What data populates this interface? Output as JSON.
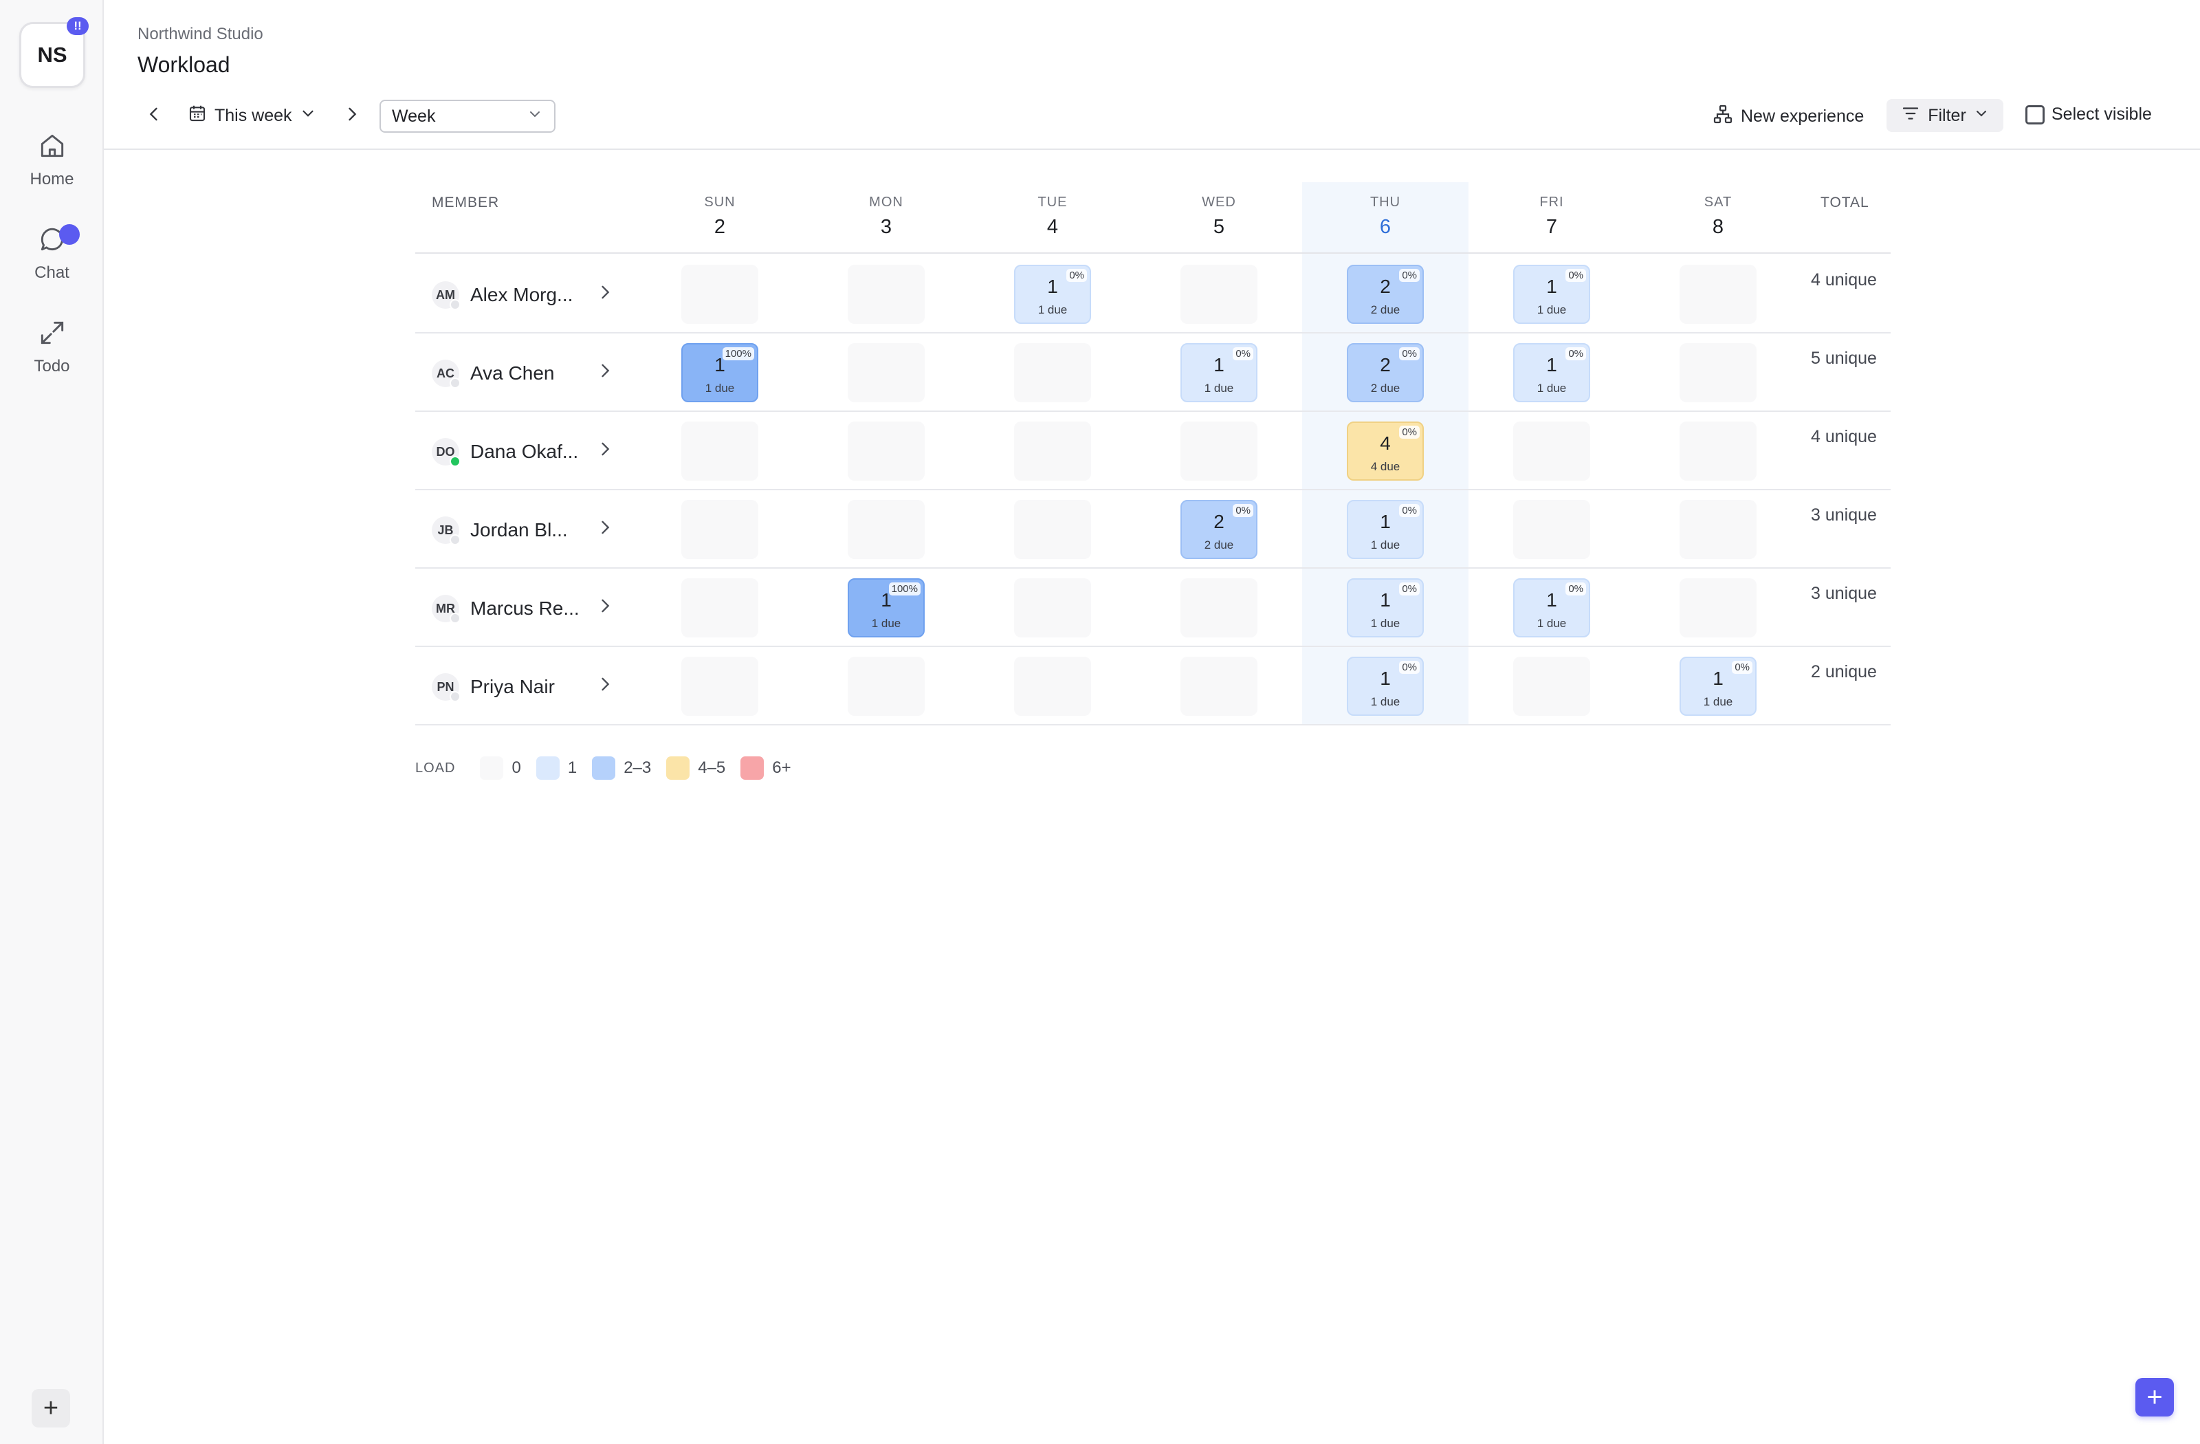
{
  "workspace": {
    "initials": "NS",
    "badge": "!!"
  },
  "sidebar": {
    "items": [
      {
        "label": "Home",
        "icon": "home-icon"
      },
      {
        "label": "Chat",
        "icon": "chat-icon"
      },
      {
        "label": "Todo",
        "icon": "expand-icon"
      }
    ],
    "add_label": "+"
  },
  "header": {
    "org": "Northwind Studio",
    "title": "Workload"
  },
  "toolbar": {
    "range_label": "This week",
    "view_select": "Week",
    "new_experience": "New experience",
    "filter": "Filter",
    "select_visible": "Select visible"
  },
  "grid": {
    "member_header": "MEMBER",
    "total_header": "TOTAL",
    "days": [
      {
        "dow": "SUN",
        "num": "2"
      },
      {
        "dow": "MON",
        "num": "3"
      },
      {
        "dow": "TUE",
        "num": "4"
      },
      {
        "dow": "WED",
        "num": "5"
      },
      {
        "dow": "THU",
        "num": "6"
      },
      {
        "dow": "FRI",
        "num": "7"
      },
      {
        "dow": "SAT",
        "num": "8"
      }
    ],
    "today_index": 4,
    "members": [
      {
        "initials": "AM",
        "name": "Alex Morg...",
        "online": false,
        "total": "4 unique",
        "cells": [
          null,
          null,
          {
            "count": "1",
            "due": "1 due",
            "pct": "0%",
            "level": "l1"
          },
          null,
          {
            "count": "2",
            "due": "2 due",
            "pct": "0%",
            "level": "l23"
          },
          {
            "count": "1",
            "due": "1 due",
            "pct": "0%",
            "level": "l1"
          },
          null
        ]
      },
      {
        "initials": "AC",
        "name": "Ava Chen",
        "online": false,
        "total": "5 unique",
        "cells": [
          {
            "count": "1",
            "due": "1 due",
            "pct": "100%",
            "level": "full"
          },
          null,
          null,
          {
            "count": "1",
            "due": "1 due",
            "pct": "0%",
            "level": "l1"
          },
          {
            "count": "2",
            "due": "2 due",
            "pct": "0%",
            "level": "l23"
          },
          {
            "count": "1",
            "due": "1 due",
            "pct": "0%",
            "level": "l1"
          },
          null
        ]
      },
      {
        "initials": "DO",
        "name": "Dana Okaf...",
        "online": true,
        "total": "4 unique",
        "cells": [
          null,
          null,
          null,
          null,
          {
            "count": "4",
            "due": "4 due",
            "pct": "0%",
            "level": "l45"
          },
          null,
          null
        ]
      },
      {
        "initials": "JB",
        "name": "Jordan Bl...",
        "online": false,
        "total": "3 unique",
        "cells": [
          null,
          null,
          null,
          {
            "count": "2",
            "due": "2 due",
            "pct": "0%",
            "level": "l23"
          },
          {
            "count": "1",
            "due": "1 due",
            "pct": "0%",
            "level": "l1"
          },
          null,
          null
        ]
      },
      {
        "initials": "MR",
        "name": "Marcus Re...",
        "online": false,
        "total": "3 unique",
        "cells": [
          null,
          {
            "count": "1",
            "due": "1 due",
            "pct": "100%",
            "level": "full"
          },
          null,
          null,
          {
            "count": "1",
            "due": "1 due",
            "pct": "0%",
            "level": "l1"
          },
          {
            "count": "1",
            "due": "1 due",
            "pct": "0%",
            "level": "l1"
          },
          null
        ]
      },
      {
        "initials": "PN",
        "name": "Priya Nair",
        "online": false,
        "total": "2 unique",
        "cells": [
          null,
          null,
          null,
          null,
          {
            "count": "1",
            "due": "1 due",
            "pct": "0%",
            "level": "l1"
          },
          null,
          {
            "count": "1",
            "due": "1 due",
            "pct": "0%",
            "level": "l1"
          }
        ]
      }
    ]
  },
  "legend": {
    "label": "LOAD",
    "items": [
      {
        "label": "0",
        "color": "#f8f8f9"
      },
      {
        "label": "1",
        "color": "#dbe9fd"
      },
      {
        "label": "2–3",
        "color": "#b5d1fb"
      },
      {
        "label": "4–5",
        "color": "#fbe4a8"
      },
      {
        "label": "6+",
        "color": "#f7a5a8"
      }
    ]
  },
  "fab_label": "+",
  "colors": {
    "accent": "#5b5bf0",
    "today": "#2f6fd8",
    "online": "#22c55e"
  }
}
